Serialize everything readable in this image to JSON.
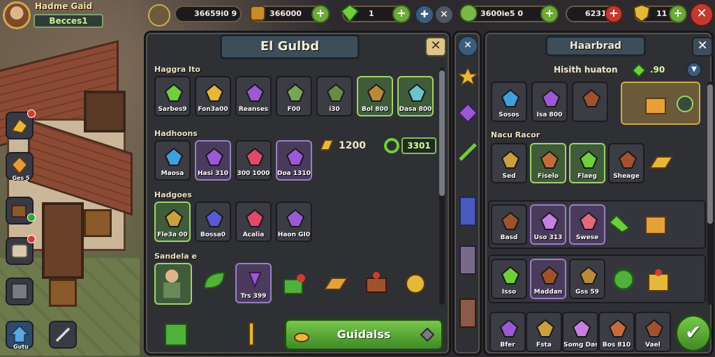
{
  "topbar": {
    "player_name": "Hadme Gaid",
    "player_tag": "Becces1",
    "currency_left_1": "36659i0 9",
    "currency_left_2": "366000",
    "currency_center": "1",
    "currency_right_1": "3600ie5 0",
    "currency_right_2": "62310",
    "currency_right_3": "11"
  },
  "sidebar": {
    "items": [
      {
        "label": "",
        "icon": "gold-bars-icon"
      },
      {
        "label": "Ges 5",
        "icon": "diamond-icon"
      },
      {
        "label": "",
        "icon": "chest-icon"
      },
      {
        "label": "",
        "icon": "scroll-icon"
      },
      {
        "label": "",
        "icon": "map-icon"
      },
      {
        "label": "Gutu",
        "icon": "house-icon"
      },
      {
        "label": "",
        "icon": "sword-icon"
      }
    ]
  },
  "guild_panel": {
    "title": "El Gulbd",
    "section1": "Haggra Ito",
    "section2": "Hadhoons",
    "section3": "Hadgoes",
    "section4": "Sandela e",
    "row1": [
      {
        "label": "Sarbes9",
        "color": "#6fcf3a"
      },
      {
        "label": "Fon3a00",
        "color": "#e6b83a"
      },
      {
        "label": "Reanses",
        "color": "#9b59d6"
      },
      {
        "label": "F00",
        "color": "#7aa35a"
      },
      {
        "label": "i30",
        "color": "#6a8a4a"
      },
      {
        "label": "Bol 800",
        "color": "#b88a3a"
      },
      {
        "label": "Dasa 800",
        "color": "#6ac4c9"
      }
    ],
    "row2": [
      {
        "label": "Maosa",
        "color": "#3ea0e0"
      },
      {
        "label": "Hasi 310",
        "color": "#9b59d6"
      },
      {
        "label": "300 1000",
        "color": "#e04a6a"
      },
      {
        "label": "Doa 1310",
        "color": "#9b59d6"
      }
    ],
    "row2_gold": "1200",
    "row2_value": "3301",
    "row3": [
      {
        "label": "Fle3a 00",
        "color": "#c9a03a"
      },
      {
        "label": "Bossa0",
        "color": "#5a5ad6"
      },
      {
        "label": "Acalia",
        "color": "#e04a6a"
      },
      {
        "label": "Haon GI0",
        "color": "#9b59d6"
      }
    ],
    "row4_label": "Trs 399",
    "guild_button": "Guidalss"
  },
  "right_panel": {
    "title": "Haarbrad",
    "header": "Hisith huaton",
    "header_value": ".90",
    "section1": "Nacu Racor",
    "row1": [
      {
        "label": "Sosos",
        "color": "#3ea0e0"
      },
      {
        "label": "Isa 800",
        "color": "#9b59d6"
      },
      {
        "label": "",
        "color": "#a0522d"
      }
    ],
    "row2": [
      {
        "label": "Sed",
        "color": "#c9a03a"
      },
      {
        "label": "Fiselo",
        "color": "#c46a3a"
      },
      {
        "label": "Flaeg",
        "color": "#6fcf3a"
      },
      {
        "label": "Sheage",
        "color": "#a0522d"
      }
    ],
    "row3": [
      {
        "label": "Basd",
        "color": "#a0522d"
      },
      {
        "label": "Uso 313",
        "color": "#c77fe0"
      },
      {
        "label": "Swese",
        "color": "#e06a7a"
      }
    ],
    "row4": [
      {
        "label": "Isso",
        "color": "#6fcf3a"
      },
      {
        "label": "Maddan",
        "color": "#a0522d"
      },
      {
        "label": "Gss 59",
        "color": "#b88a3a"
      }
    ],
    "row5": [
      {
        "label": "Bfer",
        "color": "#9b59d6"
      },
      {
        "label": "Fsta",
        "color": "#c9a03a"
      },
      {
        "label": "Somg Das",
        "color": "#c77fe0"
      },
      {
        "label": "Bos 810",
        "color": "#c96a3a"
      },
      {
        "label": "Vael",
        "color": "#a0522d"
      }
    ]
  }
}
